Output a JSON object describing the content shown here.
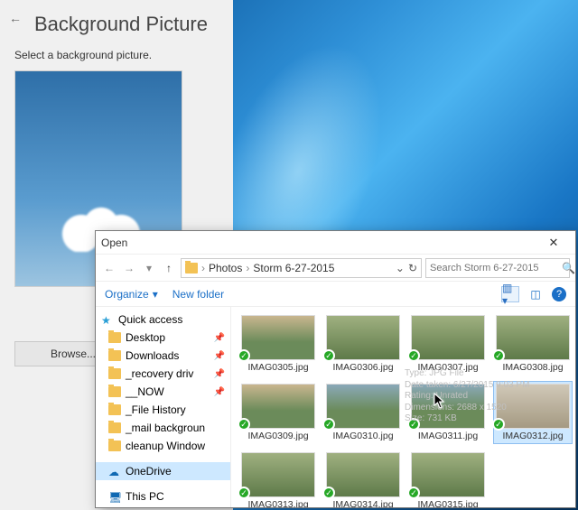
{
  "panel": {
    "title": "Background Picture",
    "subtitle": "Select a background picture.",
    "browse": "Browse..."
  },
  "dialog": {
    "title": "Open",
    "search_placeholder": "Search Storm 6-27-2015",
    "organize": "Organize",
    "new_folder": "New folder",
    "breadcrumb": {
      "root": "Photos",
      "folder": "Storm 6-27-2015"
    }
  },
  "tree": {
    "quick": "Quick access",
    "items": [
      {
        "label": "Desktop",
        "pinned": true
      },
      {
        "label": "Downloads",
        "pinned": true
      },
      {
        "label": "_recovery driv",
        "pinned": true
      },
      {
        "label": "__NOW",
        "pinned": true
      },
      {
        "label": "_File History",
        "pinned": false
      },
      {
        "label": "_mail backgroun",
        "pinned": false
      },
      {
        "label": "cleanup Window",
        "pinned": false
      }
    ],
    "onedrive": "OneDrive",
    "thispc": "This PC"
  },
  "files": [
    {
      "name": "IMAG0305.jpg",
      "style": "sky"
    },
    {
      "name": "IMAG0306.jpg",
      "style": "field"
    },
    {
      "name": "IMAG0307.jpg",
      "style": "field"
    },
    {
      "name": "IMAG0308.jpg",
      "style": "field"
    },
    {
      "name": "IMAG0309.jpg",
      "style": "sky"
    },
    {
      "name": "IMAG0310.jpg",
      "style": "water"
    },
    {
      "name": "IMAG0311.jpg",
      "style": "water"
    },
    {
      "name": "IMAG0312.jpg",
      "style": "haze",
      "selected": true
    },
    {
      "name": "IMAG0313.jpg",
      "style": "field"
    },
    {
      "name": "IMAG0314.jpg",
      "style": "field"
    },
    {
      "name": "IMAG0315.jpg",
      "style": "field"
    }
  ],
  "tooltip": {
    "l1": "Type: JPG File",
    "l2": "Date taken: 6/27/2015 9:03 PM",
    "l3": "Rating: Unrated",
    "l4": "Dimensions: 2688 x 1520",
    "l5": "Size: 731 KB"
  }
}
